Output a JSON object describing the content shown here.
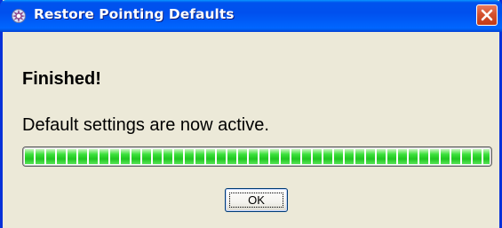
{
  "window": {
    "title": "Restore Pointing Defaults",
    "icon": "app-gear-icon",
    "close_icon": "close-icon"
  },
  "content": {
    "heading": "Finished!",
    "message": "Default settings are now active.",
    "progress_fraction": 1.0
  },
  "buttons": {
    "ok_label": "OK"
  },
  "colors": {
    "titlebar": "#0054e3",
    "close_button": "#d4512e",
    "dialog_background": "#ece9d8",
    "progress_fill": "#2fd62f"
  }
}
